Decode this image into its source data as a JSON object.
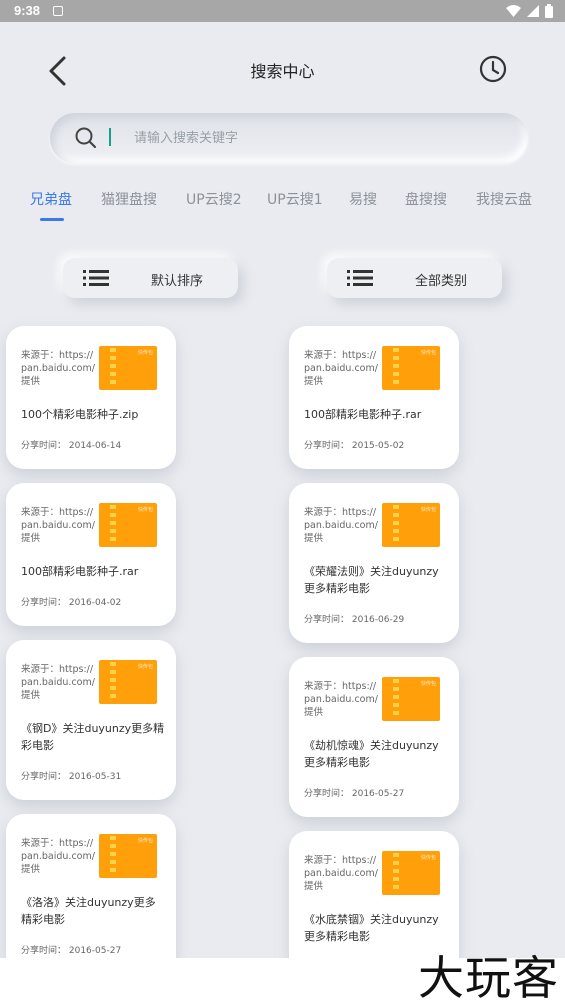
{
  "status_bar": {
    "time": "9:38"
  },
  "header": {
    "title": "搜索中心"
  },
  "search": {
    "placeholder": "请输入搜索关键字"
  },
  "tabs": [
    {
      "label": "兄弟盘",
      "active": true
    },
    {
      "label": "猫狸盘搜",
      "active": false
    },
    {
      "label": "UP云搜2",
      "active": false
    },
    {
      "label": "UP云搜1",
      "active": false
    },
    {
      "label": "易搜",
      "active": false
    },
    {
      "label": "盘搜搜",
      "active": false
    },
    {
      "label": "我搜云盘",
      "active": false
    }
  ],
  "sort": {
    "label": "默认排序"
  },
  "category": {
    "label": "全部类别"
  },
  "results": [
    {
      "source": "来源于：https://pan.baidu.com/提供",
      "name": "100个精彩电影种子.zip",
      "time": "分享时间：  2014-06-14",
      "thumb_brand": "快传包"
    },
    {
      "source": "来源于：https://pan.baidu.com/提供",
      "name": "100部精彩电影种子.rar",
      "time": "分享时间：  2015-05-02",
      "thumb_brand": "快传包"
    },
    {
      "source": "来源于：https://pan.baidu.com/提供",
      "name": "100部精彩电影种子.rar",
      "time": "分享时间：  2016-04-02",
      "thumb_brand": "快传包"
    },
    {
      "source": "来源于：https://pan.baidu.com/提供",
      "name": "《荣耀法则》关注duyunzy更多精彩电影",
      "time": "分享时间：  2016-06-29",
      "thumb_brand": "快传包"
    },
    {
      "source": "来源于：https://pan.baidu.com/提供",
      "name": "《钢D》关注duyunzy更多精彩电影",
      "time": "分享时间：  2016-05-31",
      "thumb_brand": "快传包"
    },
    {
      "source": "来源于：https://pan.baidu.com/提供",
      "name": "《劫机惊魂》关注duyunzy更多精彩电影",
      "time": "分享时间：  2016-05-27",
      "thumb_brand": "快传包"
    },
    {
      "source": "来源于：https://pan.baidu.com/提供",
      "name": "《洛洛》关注duyunzy更多精彩电影",
      "time": "分享时间：  2016-05-27",
      "thumb_brand": "快传包"
    },
    {
      "source": "来源于：https://pan.baidu.com/提供",
      "name": "《水底禁锢》关注duyunzy更多精彩电影",
      "time": "",
      "thumb_brand": "快传包"
    }
  ],
  "watermark": "大玩客",
  "colors": {
    "accent": "#3a7be8",
    "thumb": "#ff9f0a",
    "background": "#e9ebf0"
  },
  "icons": [
    "back-arrow-icon",
    "history-clock-icon",
    "search-icon",
    "list-icon",
    "wifi-icon",
    "signal-icon",
    "battery-icon"
  ]
}
